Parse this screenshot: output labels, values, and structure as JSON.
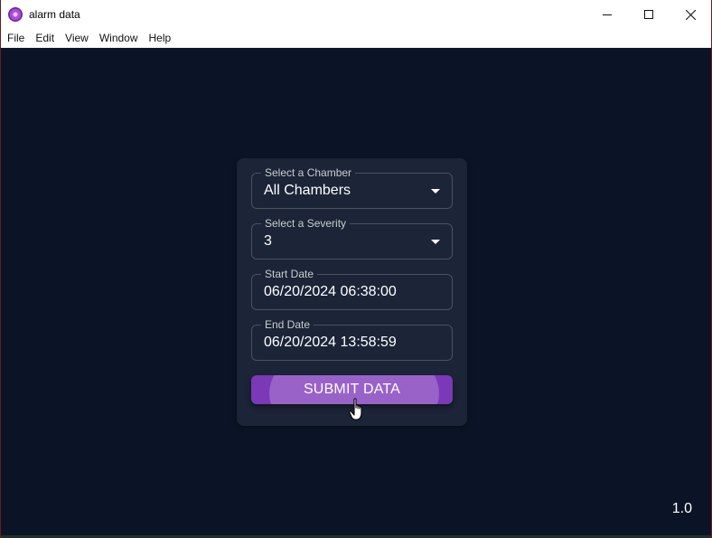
{
  "window": {
    "title": "alarm data",
    "controls": {
      "minimize": "minimize-icon",
      "maximize": "maximize-icon",
      "close": "close-icon"
    }
  },
  "menu": {
    "items": [
      "File",
      "Edit",
      "View",
      "Window",
      "Help"
    ]
  },
  "form": {
    "chamber": {
      "label": "Select a Chamber",
      "value": "All Chambers"
    },
    "severity": {
      "label": "Select a Severity",
      "value": "3"
    },
    "start_date": {
      "label": "Start Date",
      "value": "06/20/2024 06:38:00"
    },
    "end_date": {
      "label": "End Date",
      "value": "06/20/2024 13:58:59"
    },
    "submit_label": "SUBMIT DATA"
  },
  "version": "1.0",
  "colors": {
    "background": "#0b1426",
    "card": "#1b2537",
    "accent": "#7b38b7"
  }
}
